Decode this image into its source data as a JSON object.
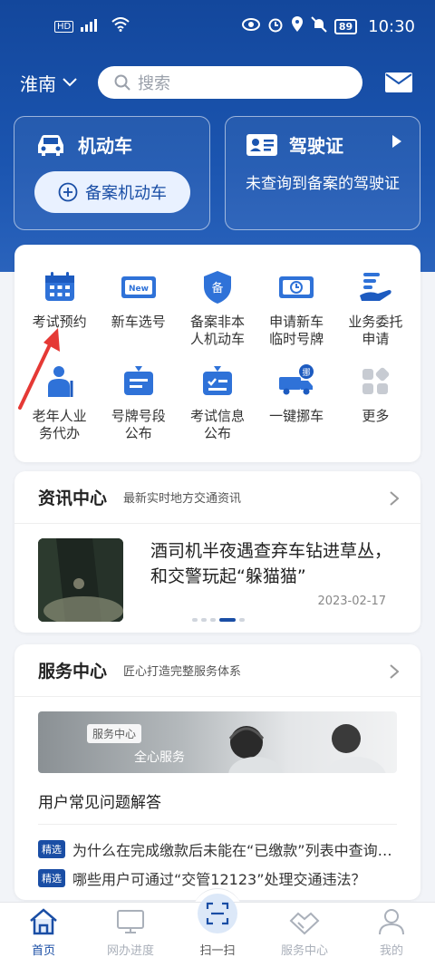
{
  "status_bar": {
    "time": "10:30",
    "battery": "89"
  },
  "header": {
    "city": "淮南",
    "search_placeholder": "搜索"
  },
  "vehicle_card": {
    "title": "机动车",
    "register_button": "备案机动车"
  },
  "license_card": {
    "title": "驾驶证",
    "message": "未查询到备案的驾驶证"
  },
  "services": [
    {
      "label": "考试预约",
      "icon": "calendar-icon"
    },
    {
      "label": "新车选号",
      "icon": "new-plate-icon"
    },
    {
      "label": "备案非本人机动车",
      "icon": "shield-bei-icon"
    },
    {
      "label": "申请新车临时号牌",
      "icon": "temp-plate-icon"
    },
    {
      "label": "业务委托申请",
      "icon": "hand-delegate-icon"
    },
    {
      "label": "老年人业务代办",
      "icon": "elderly-icon"
    },
    {
      "label": "号牌号段公布",
      "icon": "plate-range-icon"
    },
    {
      "label": "考试信息公布",
      "icon": "exam-info-icon"
    },
    {
      "label": "一键挪车",
      "icon": "tow-truck-icon"
    },
    {
      "label": "更多",
      "icon": "more-icon"
    }
  ],
  "news": {
    "title": "资讯中心",
    "subtitle": "最新实时地方交通资讯",
    "headline": "酒司机半夜遇查弃车钻进草丛，和交警玩起“躲猫猫”",
    "date": "2023-02-17"
  },
  "service_center": {
    "title": "服务中心",
    "subtitle": "匠心打造完整服务体系",
    "banner_tag": "服务中心",
    "banner_text": "全心服务",
    "faq_title": "用户常见问题解答",
    "faq_badge": "精选",
    "faq": [
      "为什么在完成缴款后未能在“已缴款”列表中查询…",
      "哪些用户可通过“交管12123”处理交通违法？"
    ]
  },
  "tabs": [
    "首页",
    "网办进度",
    "扫一扫",
    "服务中心",
    "我的"
  ],
  "colors": {
    "primary": "#1a4ea5",
    "hero": "#1b55b0",
    "annotation": "#e53935"
  }
}
